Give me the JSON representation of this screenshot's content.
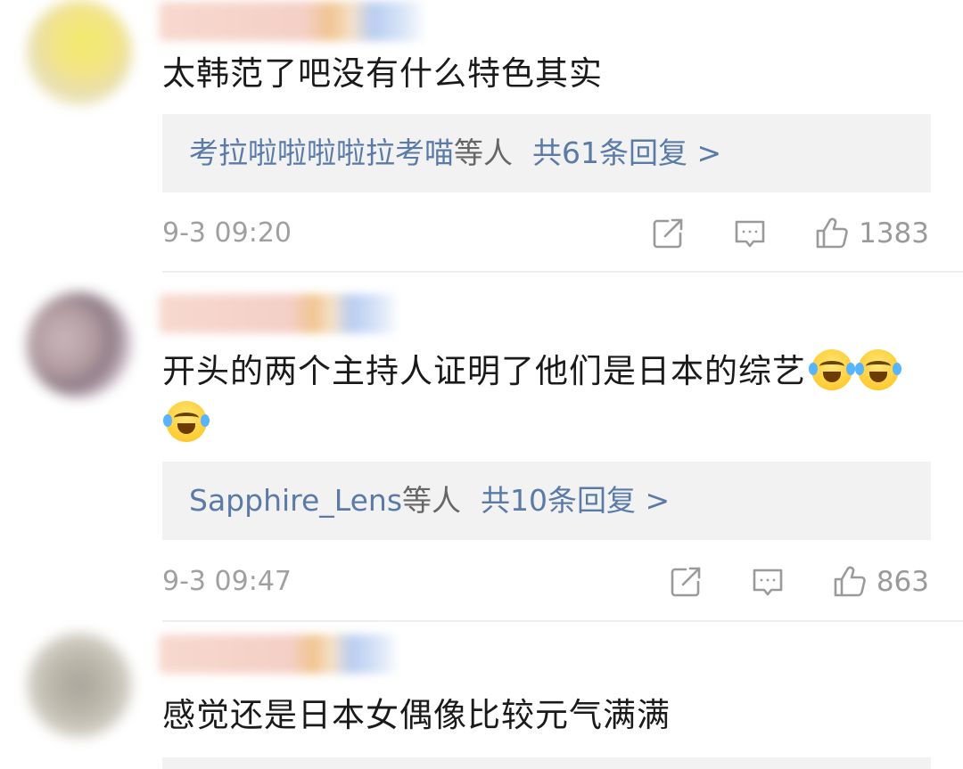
{
  "comments": [
    {
      "text": "太韩范了吧没有什么特色其实",
      "replies": {
        "names": "考拉啦啦啦啦拉考喵",
        "others": "等人",
        "count": "共61条回复 >"
      },
      "time": "9-3 09:20",
      "likes": "1383"
    },
    {
      "text": "开头的两个主持人证明了他们是日本的综艺",
      "replies": {
        "names": "Sapphire_Lens",
        "others": "等人",
        "count": "共10条回复 >"
      },
      "time": "9-3 09:47",
      "likes": "863"
    },
    {
      "text": "感觉还是日本女偶像比较元气满满"
    }
  ],
  "icons": {
    "repost": "share-icon",
    "comment": "comment-icon",
    "like": "thumbs-up-icon",
    "emoji": "laughing-crying-emoji"
  },
  "colors": {
    "link": "#5a7aa8",
    "meta": "#a0a0a0",
    "reply_bg": "#f2f2f2"
  }
}
